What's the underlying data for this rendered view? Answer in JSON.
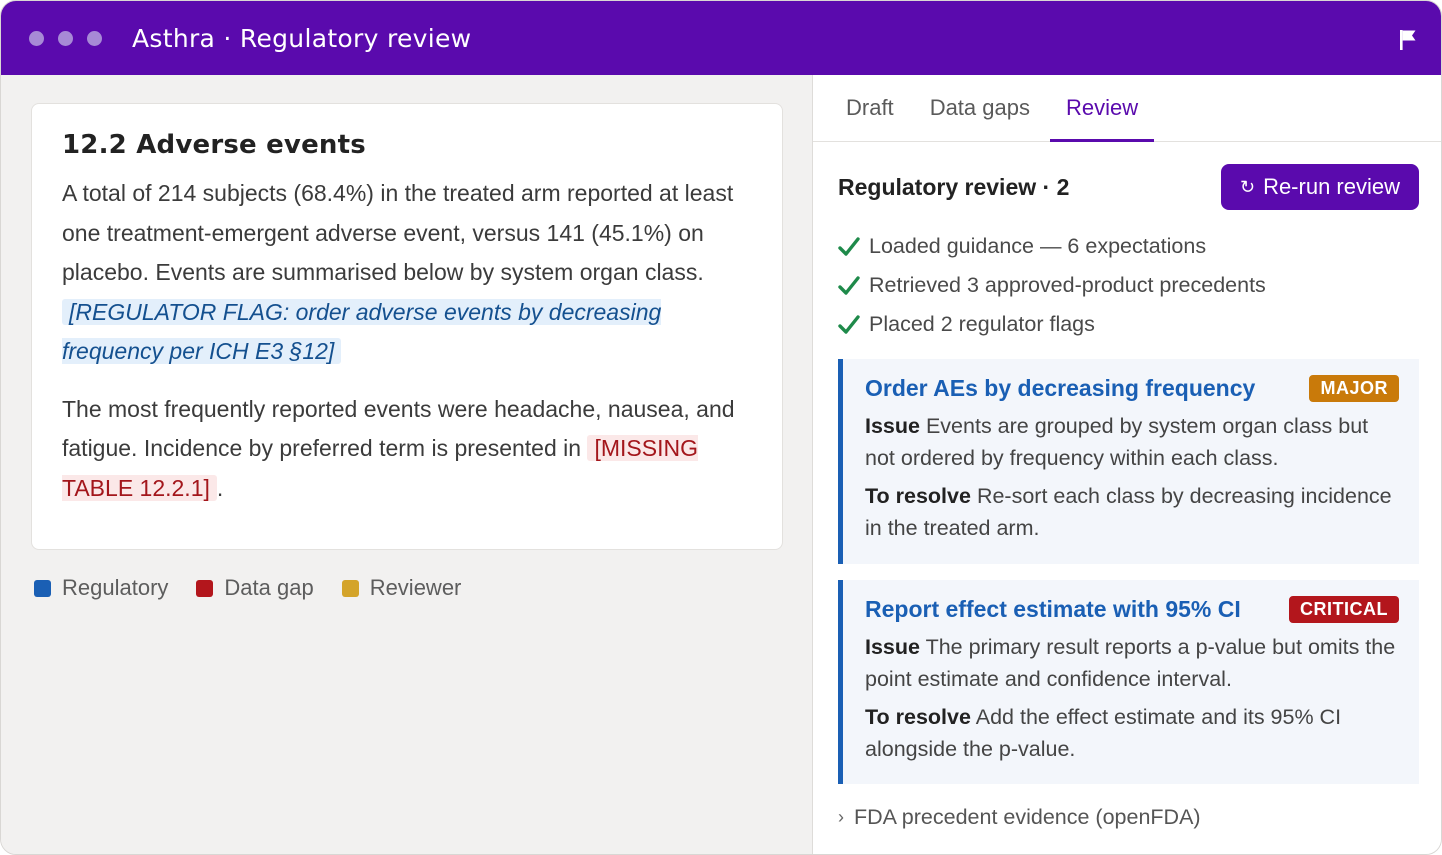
{
  "window": {
    "title": "Asthra · Regulatory review"
  },
  "document": {
    "heading": "12.2 Adverse events",
    "para1_text": "A total of 214 subjects (68.4%) in the treated arm reported at least one treatment-emergent adverse event, versus 141 (45.1%) on placebo. Events are summarised below by system organ class.",
    "regulator_flag": "[REGULATOR FLAG: order adverse events by decreasing frequency per ICH E3 §12]",
    "para2_text": "The most frequently reported events were headache, nausea, and fatigue. Incidence by preferred term is presented in",
    "missing_flag": "[MISSING TABLE 12.2.1]",
    "para2_end": "."
  },
  "legend": [
    {
      "label": "Regulatory",
      "color": "#1a5fb4"
    },
    {
      "label": "Data gap",
      "color": "#b3161c"
    },
    {
      "label": "Reviewer",
      "color": "#d4a42a"
    }
  ],
  "tabs": [
    {
      "label": "Draft",
      "active": false
    },
    {
      "label": "Data gaps",
      "active": false
    },
    {
      "label": "Review",
      "active": true
    }
  ],
  "review": {
    "title": "Regulatory review · 2",
    "rerun_label": "Re-run review",
    "rerun_icon": "↻",
    "checklist": [
      "Loaded guidance — 6 expectations",
      "Retrieved 3 approved-product precedents",
      "Placed 2 regulator flags"
    ],
    "issue_label": "Issue",
    "resolve_label": "To resolve",
    "issues": [
      {
        "title": "Order AEs by decreasing frequency",
        "severity": "MAJOR",
        "severity_color": "#c97a0a",
        "issue": "Events are grouped by system organ class but not ordered by frequency within each class.",
        "resolve": "Re-sort each class by decreasing incidence in the treated arm."
      },
      {
        "title": "Report effect estimate with 95% CI",
        "severity": "CRITICAL",
        "severity_color": "#b3161c",
        "issue": "The primary result reports a p-value but omits the point estimate and confidence interval.",
        "resolve": "Add the effect estimate and its 95% CI alongside the p-value."
      }
    ],
    "evidence_label": "FDA precedent evidence (openFDA)",
    "evidence_chevron": "›"
  },
  "colors": {
    "brand": "#5a0aad",
    "accent_blue": "#1a5fb4",
    "check_green": "#1e8a4a"
  }
}
